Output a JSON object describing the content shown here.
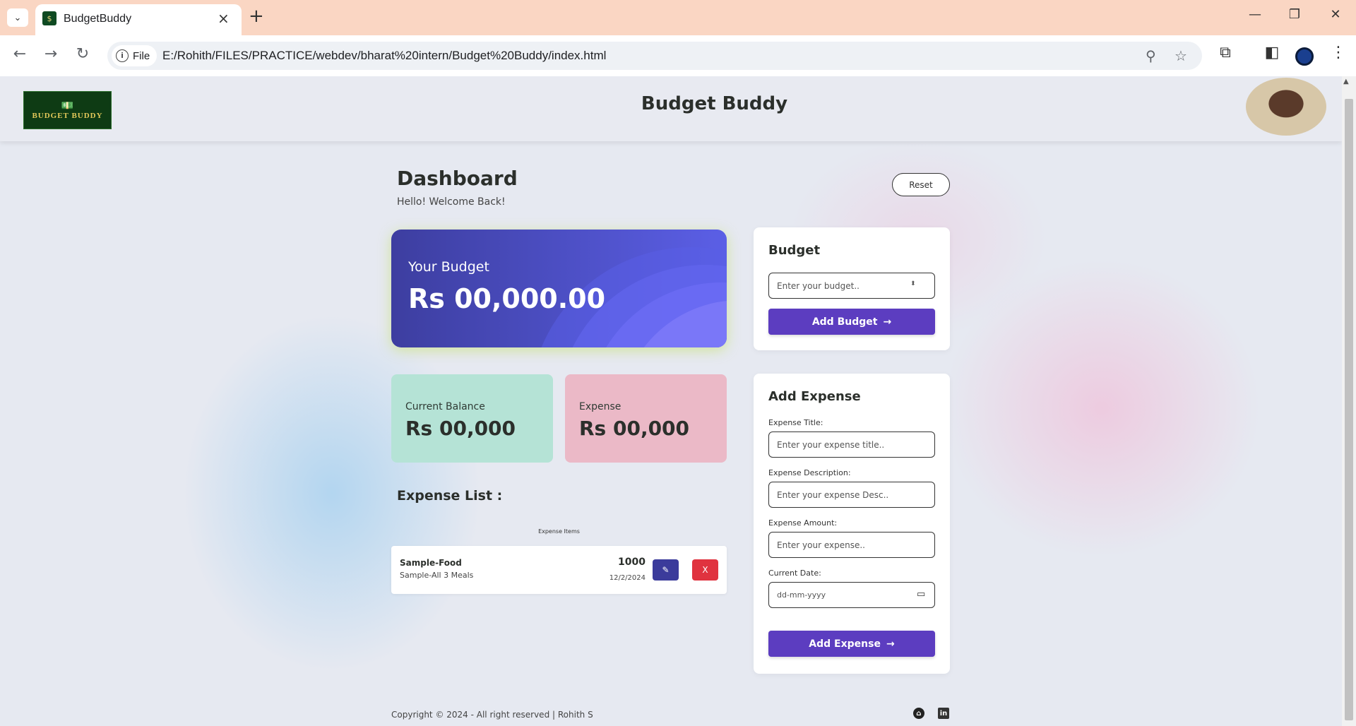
{
  "browser": {
    "tab_title": "BudgetBuddy",
    "new_tab": "+",
    "file_chip": "File",
    "url": "E:/Rohith/FILES/PRACTICE/webdev/bharat%20intern/Budget%20Buddy/index.html"
  },
  "header": {
    "logo_text": "BUDGET BUDDY",
    "title": "Budget Buddy"
  },
  "dashboard": {
    "title": "Dashboard",
    "subtitle": "Hello! Welcome Back!",
    "reset_label": "Reset"
  },
  "budget_card": {
    "label": "Your Budget",
    "value": "Rs 00,000.00"
  },
  "balance_card": {
    "label": "Current Balance",
    "value": "Rs 00,000",
    "color": "#b5e3d6"
  },
  "expense_card": {
    "label": "Expense",
    "value": "Rs 00,000",
    "color": "#ebb9c7"
  },
  "expense_list": {
    "title": "Expense List :",
    "caption": "Expense Items",
    "items": [
      {
        "title": "Sample-Food",
        "desc": "Sample-All 3 Meals",
        "amount": "1000",
        "date": "12/2/2024",
        "delete_label": "X"
      }
    ]
  },
  "budget_panel": {
    "title": "Budget",
    "placeholder": "Enter your budget..",
    "button": "Add Budget"
  },
  "expense_panel": {
    "title": "Add Expense",
    "title_label": "Expense Title:",
    "title_placeholder": "Enter your expense title..",
    "desc_label": "Expense Description:",
    "desc_placeholder": "Enter your expense Desc..",
    "amount_label": "Expense Amount:",
    "amount_placeholder": "Enter your expense..",
    "date_label": "Current Date:",
    "date_placeholder": "dd-mm-yyyy",
    "button": "Add Expense"
  },
  "footer": {
    "copyright": "Copyright © 2024 - All right reserved | Rohith S"
  },
  "colors": {
    "accent": "#5c3dc0",
    "edit": "#3b3b9b",
    "delete": "#e0333f"
  }
}
